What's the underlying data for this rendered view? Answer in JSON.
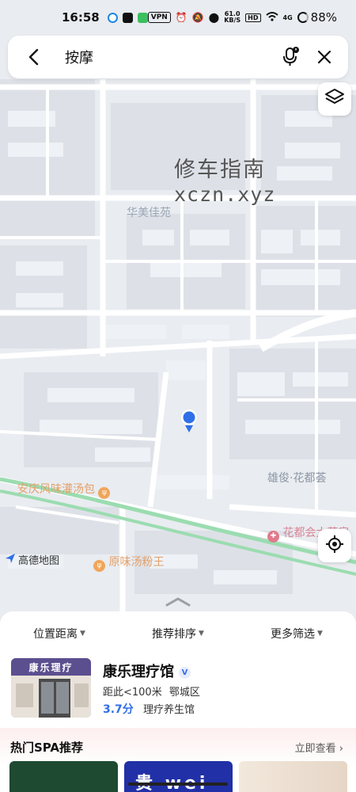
{
  "status_bar": {
    "time": "16:58",
    "vpn": "VPN",
    "net_speed_top": "61.0",
    "net_speed_bottom": "KB/S",
    "hd": "HD",
    "signal": "4G",
    "battery": "88%"
  },
  "search": {
    "query": "按摩"
  },
  "watermark": {
    "line1": "修车指南",
    "line2": "xczn.xyz"
  },
  "map": {
    "labels": {
      "huamei": "华美佳苑",
      "xiongjun": "雄俊·花都荟",
      "anqing": "安庆风味灌汤包",
      "yuanwei": "原味汤粉王",
      "huaduhui": "花都会大药房"
    },
    "logo_text": "高德地图",
    "colors": {
      "road": "#ffffff",
      "block": "#dfe3e9",
      "green_road": "#8fd8a7",
      "pin": "#2f6fe8",
      "poi_orange": "#f0a55a",
      "poi_pink": "#e07a8a"
    }
  },
  "filters": [
    {
      "label": "位置距离"
    },
    {
      "label": "推荐排序"
    },
    {
      "label": "更多筛选"
    }
  ],
  "result": {
    "name": "康乐理疗馆",
    "verified": "V",
    "distance": "距此<100米",
    "district": "鄂城区",
    "rating": "3.7分",
    "category": "理疗养生馆",
    "thumb_sign": "康乐理疗"
  },
  "spa": {
    "title": "热门SPA推荐",
    "more": "立即查看",
    "card2_text": "贵 wei 良"
  }
}
